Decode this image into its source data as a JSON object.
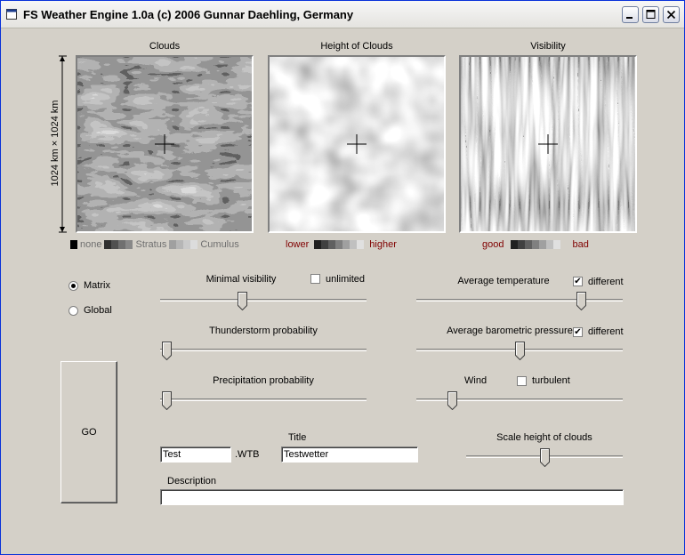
{
  "window": {
    "title": "FS Weather Engine 1.0a (c) 2006 Gunnar Daehling, Germany"
  },
  "maps": {
    "clouds": {
      "title": "Clouds"
    },
    "height": {
      "title": "Height of Clouds"
    },
    "visibility": {
      "title": "Visibility"
    },
    "dimension_label": "1024 km × 1024 km"
  },
  "legends": {
    "clouds": {
      "none": "none",
      "stratus": "Stratus",
      "cumulus": "Cumulus"
    },
    "height": {
      "low": "lower",
      "high": "higher"
    },
    "visibility": {
      "good": "good",
      "bad": "bad"
    }
  },
  "mode": {
    "options": [
      {
        "label": "Matrix",
        "selected": true
      },
      {
        "label": "Global",
        "selected": false
      }
    ]
  },
  "controls": {
    "min_visibility": {
      "label": "Minimal visibility",
      "value": 0.39
    },
    "unlimited": {
      "label": "unlimited",
      "checked": false
    },
    "thunderstorm": {
      "label": "Thunderstorm probability",
      "value": 0.0
    },
    "precipitation": {
      "label": "Precipitation probability",
      "value": 0.0
    },
    "avg_temperature": {
      "label": "Average temperature",
      "value": 0.82
    },
    "temp_different": {
      "label": "different",
      "checked": true
    },
    "avg_pressure": {
      "label": "Average barometric pressure",
      "value": 0.5
    },
    "pressure_different": {
      "label": "different",
      "checked": true
    },
    "wind": {
      "label": "Wind",
      "value": 0.15
    },
    "turbulent": {
      "label": "turbulent",
      "checked": false
    },
    "scale_height": {
      "label": "Scale height of clouds",
      "value": 0.5
    }
  },
  "go_button": {
    "label": "GO"
  },
  "file": {
    "name_value": "Test",
    "extension": ".WTB"
  },
  "title_field": {
    "label": "Title",
    "value": "Testwetter"
  },
  "description": {
    "label": "Description",
    "value": ""
  },
  "colors": {
    "title_bar_border": "#0831d9",
    "dialog_face": "#d4d0c8",
    "legend_red": "#800000"
  }
}
